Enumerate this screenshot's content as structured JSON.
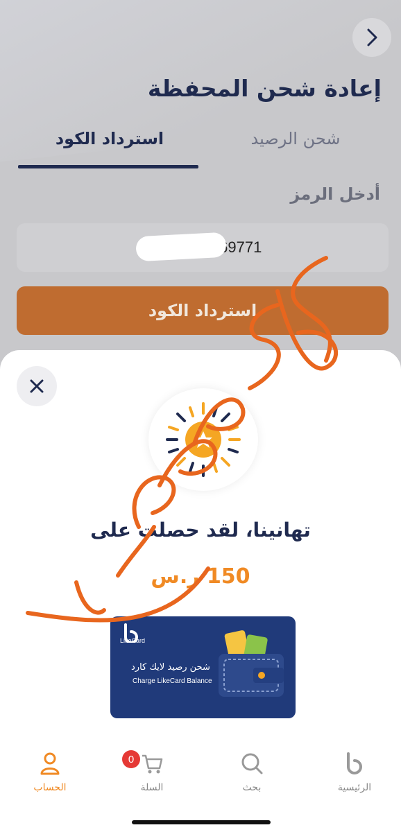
{
  "header": {
    "title": "إعادة شحن المحفظة",
    "back_icon": "chevron-right-icon"
  },
  "tabs": [
    {
      "label": "استرداد الكود",
      "active": true
    },
    {
      "label": "شحن الرصيد",
      "active": false
    }
  ],
  "form": {
    "code_label": "أدخل الرمز",
    "code_value": "7           69771",
    "submit_label": "استرداد الكود"
  },
  "sheet": {
    "close_icon": "close-icon",
    "illustration": "sun-star-icon",
    "message": "تهانينا، لقد حصلت على",
    "amount": "150 ر.س",
    "card": {
      "brand": "LikeCard",
      "label_ar": "شحن رصيد لايك كارد",
      "label_en": "Charge LikeCard Balance"
    }
  },
  "tabbar": {
    "items": [
      {
        "label": "الحساب",
        "icon": "user-icon",
        "active": true
      },
      {
        "label": "السلة",
        "icon": "cart-icon",
        "badge": "0"
      },
      {
        "label": "بحث",
        "icon": "search-icon"
      },
      {
        "label": "الرئيسية",
        "icon": "home-logo-icon"
      }
    ]
  },
  "colors": {
    "accent": "#f08a24",
    "primary": "#1f2a4f",
    "button": "#bf6c30",
    "card": "#203a7a"
  }
}
